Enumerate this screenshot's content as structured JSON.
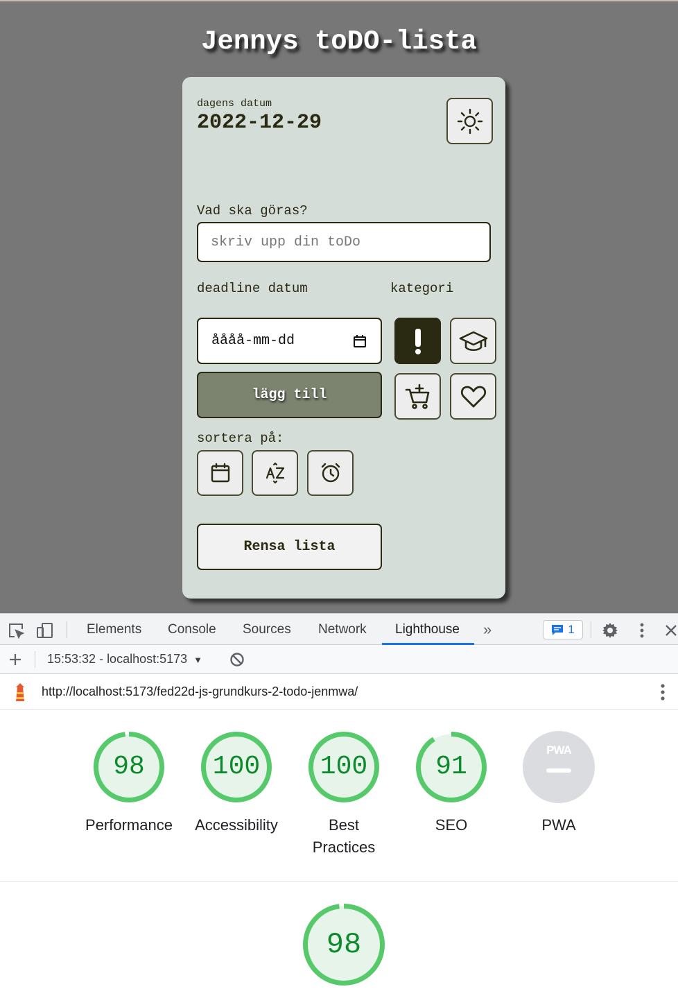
{
  "app": {
    "title": "Jennys toDO-lista",
    "date_caption": "dagens datum",
    "date_value": "2022-12-29",
    "todo_label": "Vad ska göras?",
    "todo_placeholder": "skriv upp din toDo",
    "deadline_label": "deadline datum",
    "category_label": "kategori",
    "date_input_value": "åååå-mm-dd",
    "add_button": "lägg till",
    "sort_label": "sortera på:",
    "clear_button": "Rensa lista",
    "categories": [
      {
        "icon": "exclamation-icon",
        "active": true
      },
      {
        "icon": "graduation-cap-icon",
        "active": false
      },
      {
        "icon": "cart-plus-icon",
        "active": false
      },
      {
        "icon": "heart-icon",
        "active": false
      }
    ],
    "sort_options": [
      "calendar-icon",
      "sort-az-icon",
      "alarm-clock-icon"
    ],
    "colors": {
      "background": "#777777",
      "card": "#d4ddd7",
      "dark": "#2a2a12",
      "add_button": "#7c8470"
    }
  },
  "devtools": {
    "tabs": [
      {
        "label": "Elements",
        "active": false
      },
      {
        "label": "Console",
        "active": false
      },
      {
        "label": "Sources",
        "active": false
      },
      {
        "label": "Network",
        "active": false
      },
      {
        "label": "Lighthouse",
        "active": true
      }
    ],
    "more_tabs": "»",
    "issues_count": "1",
    "report_select": "15:53:32 - localhost:5173",
    "report_url": "http://localhost:5173/fed22d-js-grundkurs-2-todo-jenmwa/",
    "scores": [
      {
        "label": "Performance",
        "value": "98",
        "fraction": 0.98
      },
      {
        "label": "Accessibility",
        "value": "100",
        "fraction": 1.0
      },
      {
        "label": "Best Practices",
        "value": "100",
        "fraction": 1.0
      },
      {
        "label": "SEO",
        "value": "91",
        "fraction": 0.91
      },
      {
        "label": "PWA",
        "value": "",
        "fraction": 0
      }
    ],
    "pwa_badge": "PWA",
    "focused_score": {
      "value": "98",
      "fraction": 0.98
    },
    "colors": {
      "pass": "#0c8a2c",
      "ring": "#56c96a",
      "ring_bg": "#e6f4ea",
      "accent": "#1a73e8"
    }
  }
}
